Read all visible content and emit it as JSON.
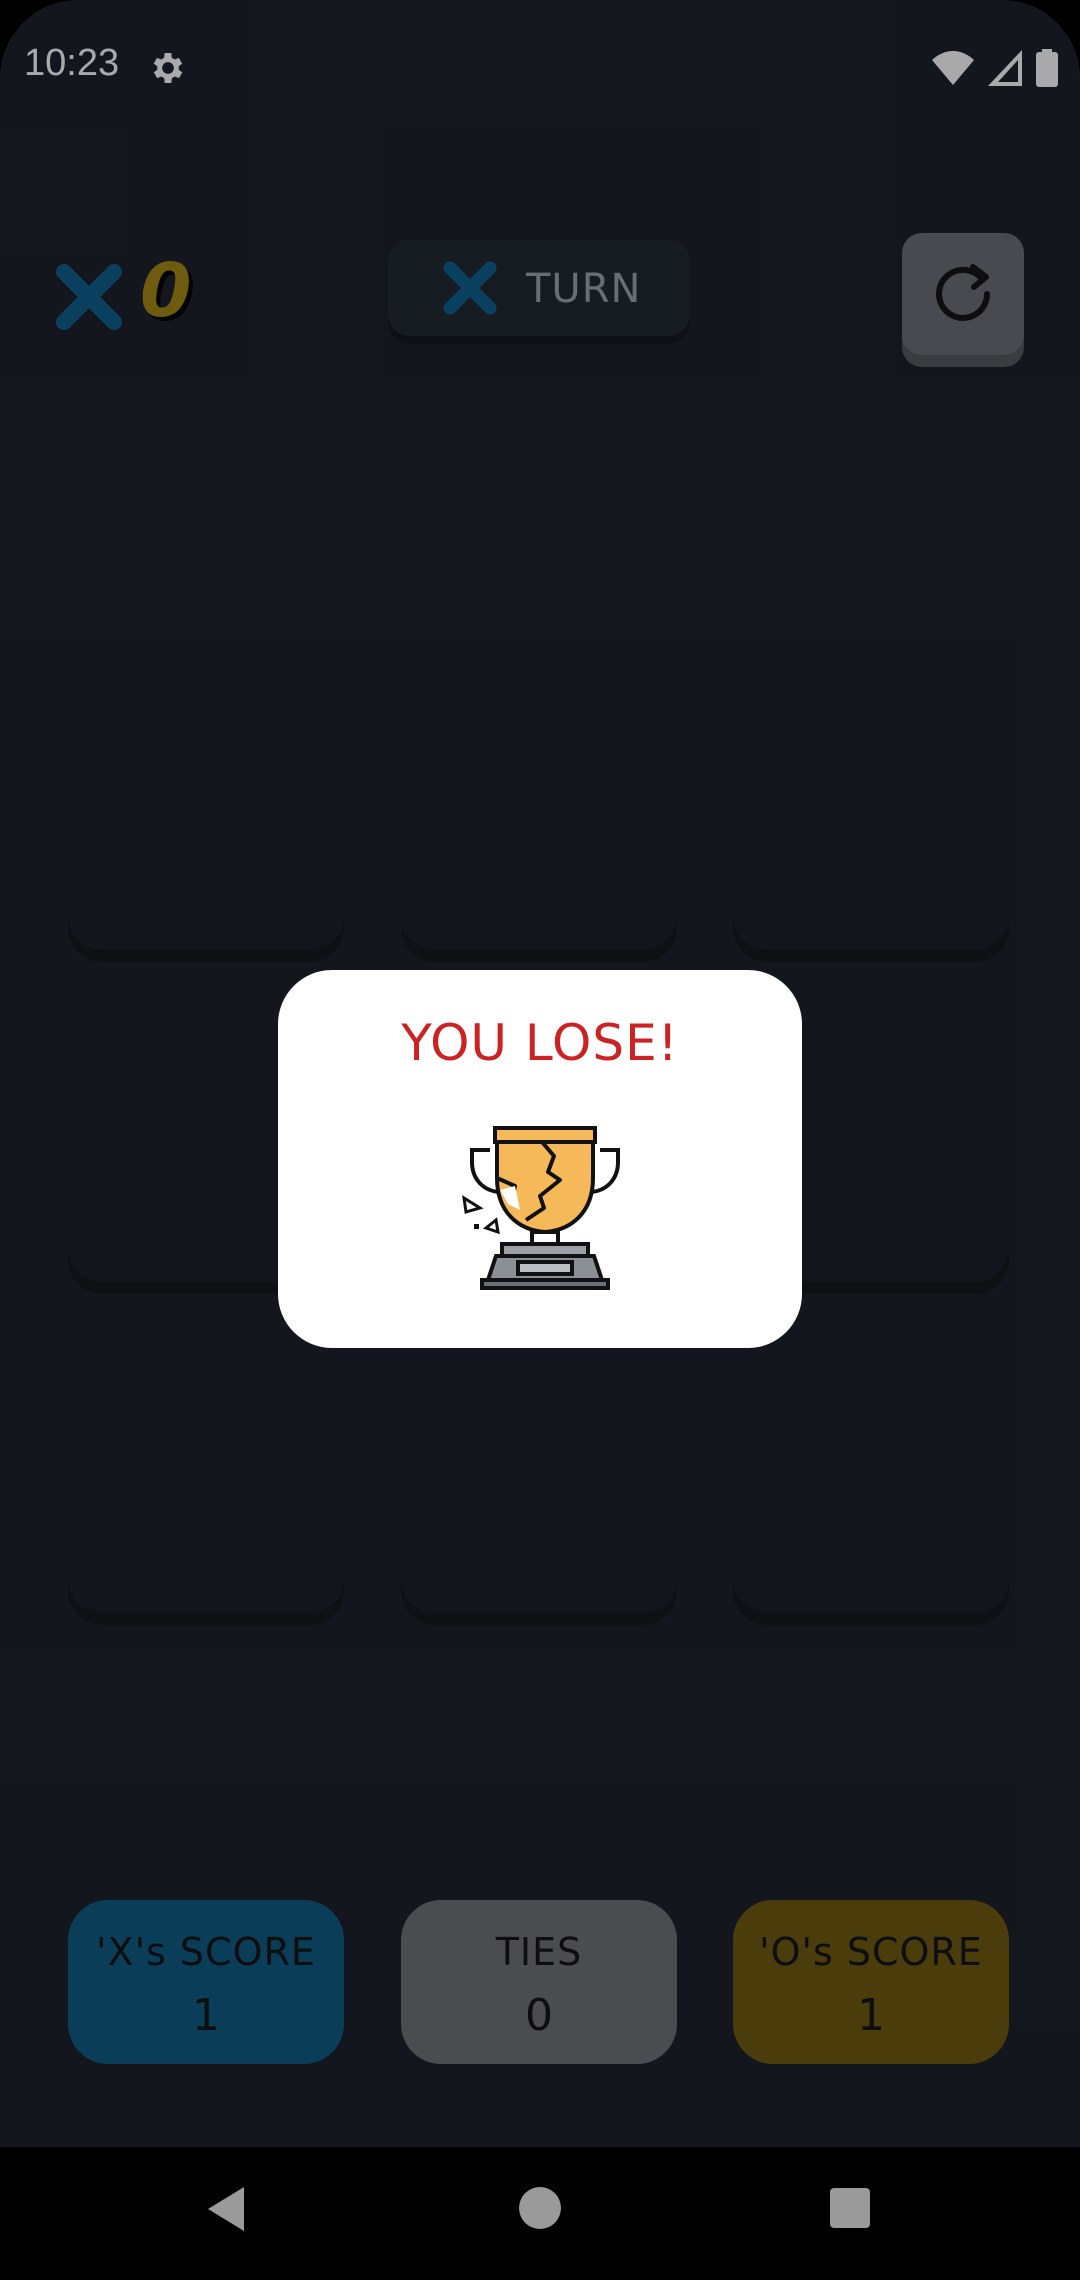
{
  "status_bar": {
    "time": "10:23",
    "icons": [
      "gear-icon",
      "wifi-icon",
      "signal-icon",
      "battery-icon"
    ]
  },
  "header": {
    "x_player_score": "0",
    "turn_label": "TURN",
    "turn_symbol_icon": "x-icon",
    "restart_icon": "restart-icon"
  },
  "board": {
    "cells": [
      "",
      "",
      "",
      "",
      "",
      "",
      "",
      "",
      ""
    ]
  },
  "dialog": {
    "title": "YOU LOSE!",
    "image_icon": "broken-trophy-icon"
  },
  "scores": [
    {
      "label": "'X's SCORE",
      "value": "1",
      "color": "#0b5a80"
    },
    {
      "label": "TIES",
      "value": "0",
      "color": "#6f7173"
    },
    {
      "label": "'O's SCORE",
      "value": "1",
      "color": "#6d5a0a"
    }
  ],
  "nav_bar": {
    "icons": [
      "back-icon",
      "home-icon",
      "recents-icon"
    ]
  },
  "colors": {
    "background": "#1a1f26",
    "x_blue": "#0c5e8a",
    "o_gold": "#a5870f",
    "lose_red": "#cc2222"
  }
}
